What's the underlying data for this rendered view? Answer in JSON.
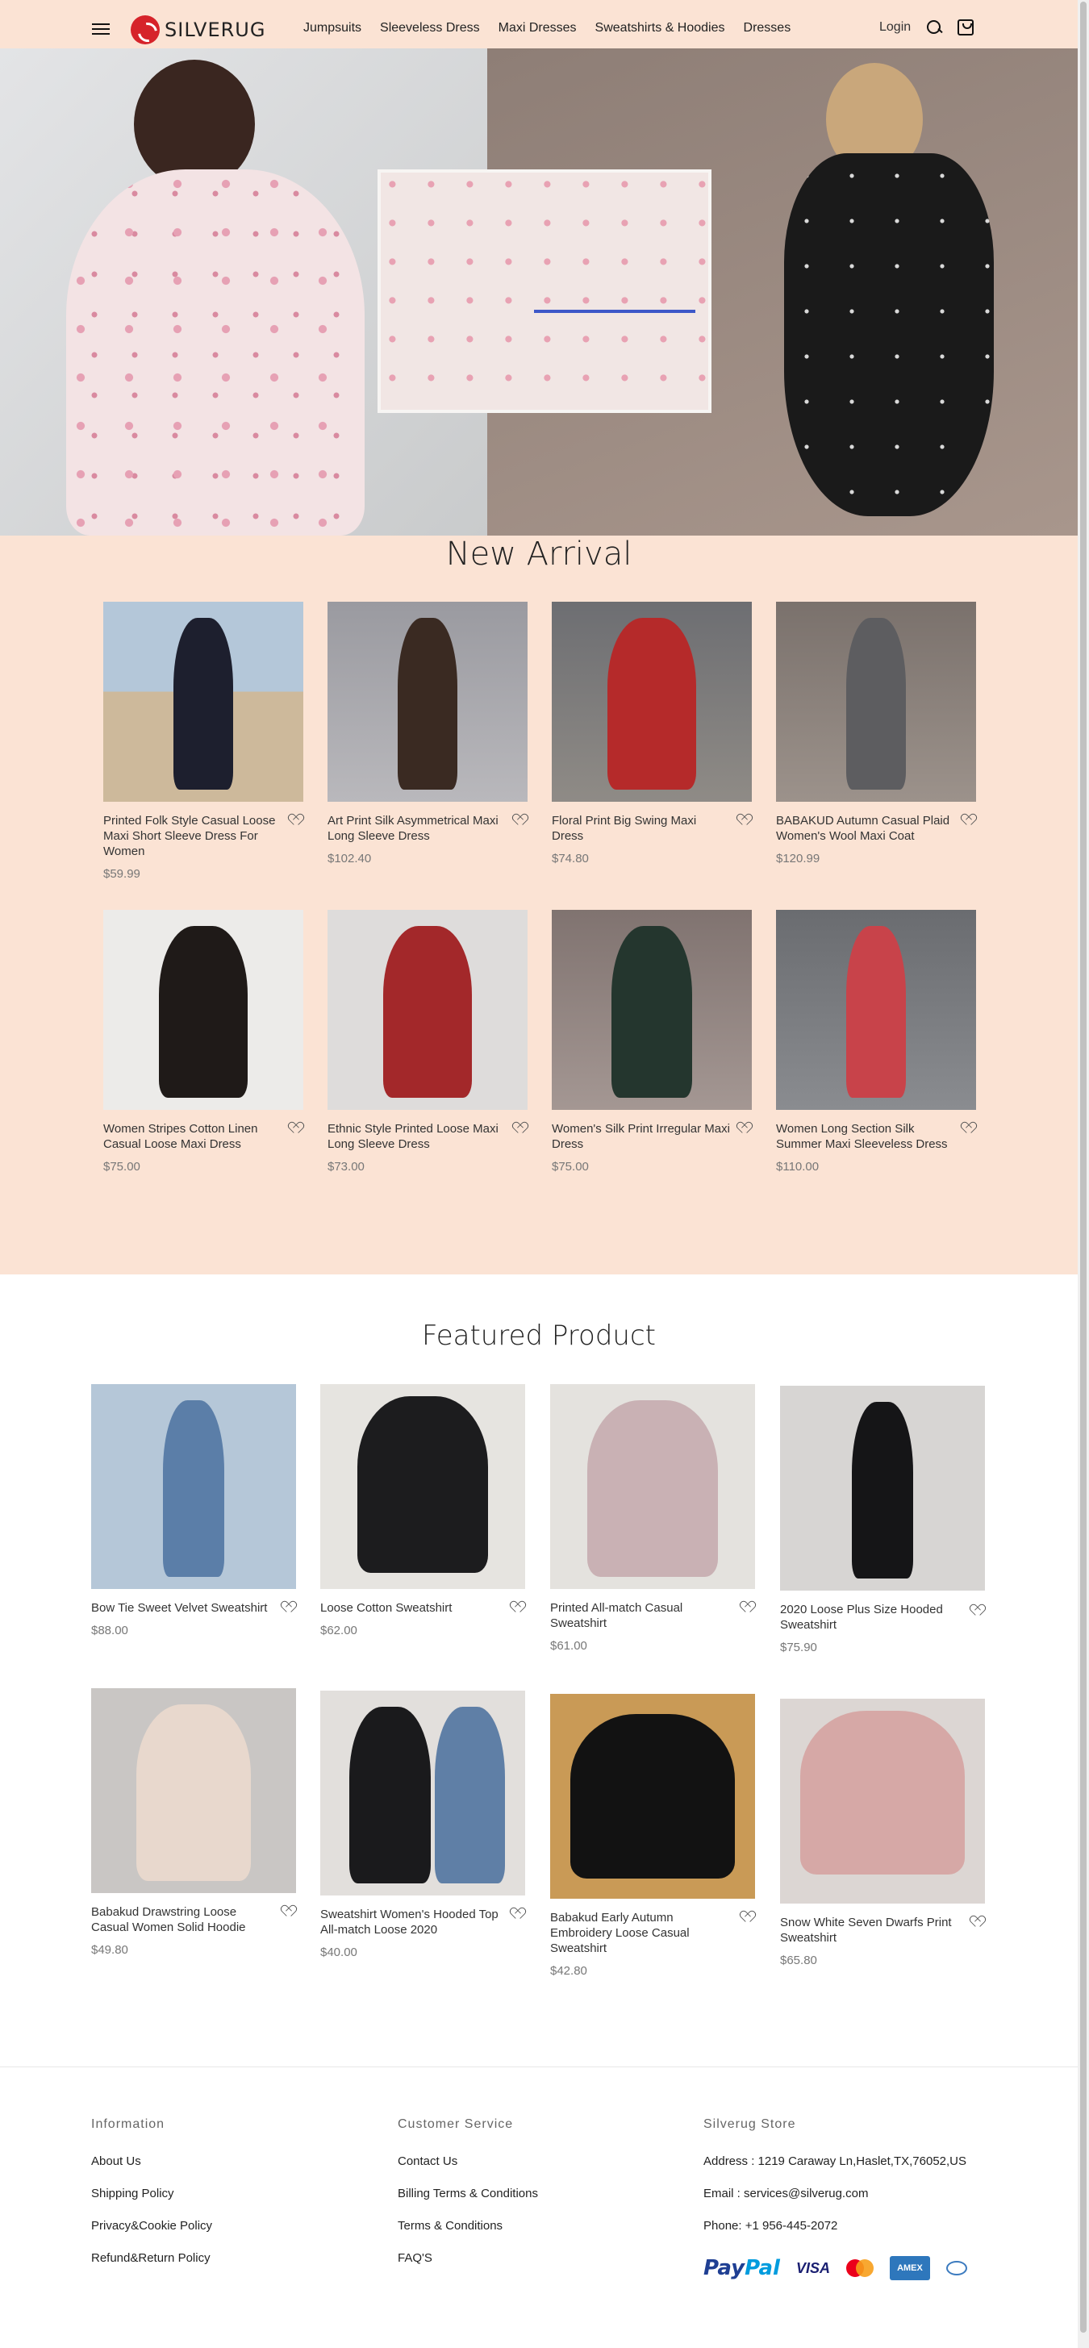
{
  "header": {
    "logo_text": "SILVERUG",
    "nav": [
      "Jumpsuits",
      "Sleeveless Dress",
      "Maxi Dresses",
      "Sweatshirts & Hoodies",
      "Dresses"
    ],
    "login": "Login"
  },
  "colors": {
    "accent_bg": "#fbe3d4",
    "logo_red": "#d6232a"
  },
  "new_arrival": {
    "title": "New Arrival",
    "items": [
      {
        "name": "Printed Folk Style Casual Loose Maxi Short Sleeve Dress For Women",
        "price": "$59.99"
      },
      {
        "name": "Art Print Silk Asymmetrical Maxi Long Sleeve Dress",
        "price": "$102.40"
      },
      {
        "name": "Floral Print Big Swing Maxi Dress",
        "price": "$74.80"
      },
      {
        "name": "BABAKUD Autumn Casual Plaid Women's Wool Maxi Coat",
        "price": "$120.99"
      },
      {
        "name": "Women Stripes Cotton Linen Casual Loose Maxi Dress",
        "price": "$75.00"
      },
      {
        "name": "Ethnic Style Printed Loose Maxi Long Sleeve Dress",
        "price": "$73.00"
      },
      {
        "name": "Women's Silk Print Irregular Maxi Dress",
        "price": "$75.00"
      },
      {
        "name": "Women Long Section Silk Summer Maxi Sleeveless Dress",
        "price": "$110.00"
      }
    ]
  },
  "featured": {
    "title": "Featured Product",
    "items": [
      {
        "name": "Bow Tie Sweet Velvet Sweatshirt",
        "price": "$88.00"
      },
      {
        "name": "Loose Cotton Sweatshirt",
        "price": "$62.00"
      },
      {
        "name": "Printed All-match Casual Sweatshirt",
        "price": "$61.00"
      },
      {
        "name": "2020 Loose Plus Size Hooded Sweatshirt",
        "price": "$75.90"
      },
      {
        "name": "Babakud Drawstring Loose Casual Women Solid Hoodie",
        "price": "$49.80"
      },
      {
        "name": "Sweatshirt Women's Hooded Top All-match Loose 2020",
        "price": "$40.00"
      },
      {
        "name": "Babakud Early Autumn Embroidery Loose Casual Sweatshirt",
        "price": "$42.80"
      },
      {
        "name": "Snow White Seven Dwarfs Print Sweatshirt",
        "price": "$65.80"
      }
    ]
  },
  "footer": {
    "information": {
      "title": "Information",
      "links": [
        "About Us",
        "Shipping Policy",
        "Privacy&Cookie Policy",
        "Refund&Return Policy"
      ]
    },
    "customer_service": {
      "title": "Customer Service",
      "links": [
        "Contact Us",
        "Billing Terms & Conditions",
        "Terms & Conditions",
        "FAQ'S"
      ]
    },
    "store": {
      "title": "Silverug Store",
      "address": "Address : 1219 Caraway Ln,Haslet,TX,76052,US",
      "email": "Email : services@silverug.com",
      "phone": "Phone: +1 956-445-2072"
    },
    "payments": {
      "paypal_a": "Pay",
      "paypal_b": "Pal",
      "visa": "VISA",
      "amex": "AMEX"
    }
  }
}
